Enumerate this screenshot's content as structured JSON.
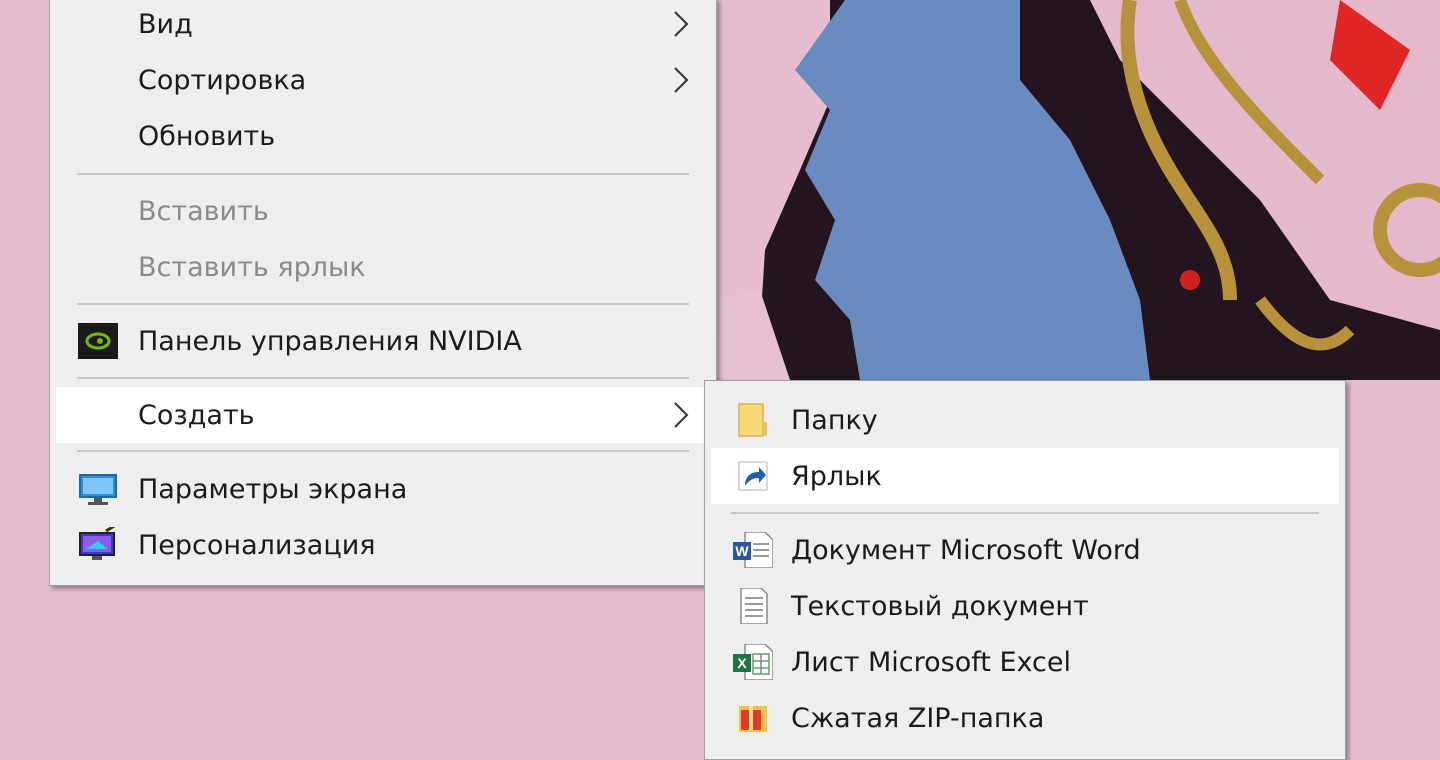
{
  "main_menu": {
    "items": [
      {
        "label": "Вид",
        "has_submenu": true,
        "enabled": true
      },
      {
        "label": "Сортировка",
        "has_submenu": true,
        "enabled": true
      },
      {
        "label": "Обновить",
        "has_submenu": false,
        "enabled": true
      },
      {
        "label": "Вставить",
        "has_submenu": false,
        "enabled": false
      },
      {
        "label": "Вставить ярлык",
        "has_submenu": false,
        "enabled": false
      },
      {
        "label": "Панель управления NVIDIA",
        "icon": "nvidia-icon",
        "has_submenu": false,
        "enabled": true
      },
      {
        "label": "Создать",
        "has_submenu": true,
        "enabled": true,
        "highlighted": true
      },
      {
        "label": "Параметры экрана",
        "icon": "display-settings-icon",
        "has_submenu": false,
        "enabled": true
      },
      {
        "label": "Персонализация",
        "icon": "personalization-icon",
        "has_submenu": false,
        "enabled": true
      }
    ]
  },
  "sub_menu": {
    "items": [
      {
        "label": "Папку",
        "icon": "folder-icon"
      },
      {
        "label": "Ярлык",
        "icon": "shortcut-icon",
        "highlighted": true
      },
      {
        "label": "Документ Microsoft Word",
        "icon": "word-document-icon"
      },
      {
        "label": "Текстовый документ",
        "icon": "text-document-icon"
      },
      {
        "label": "Лист Microsoft Excel",
        "icon": "excel-sheet-icon"
      },
      {
        "label": "Сжатая ZIP-папка",
        "icon": "zip-folder-icon"
      }
    ]
  },
  "colors": {
    "menu_bg": "#eeeeee",
    "highlight_bg": "#ffffff",
    "text": "#1b1b1b",
    "disabled_text": "#8a8a8a",
    "separator": "#c8c8c8",
    "wallpaper_pink": "#e6bdd0"
  }
}
